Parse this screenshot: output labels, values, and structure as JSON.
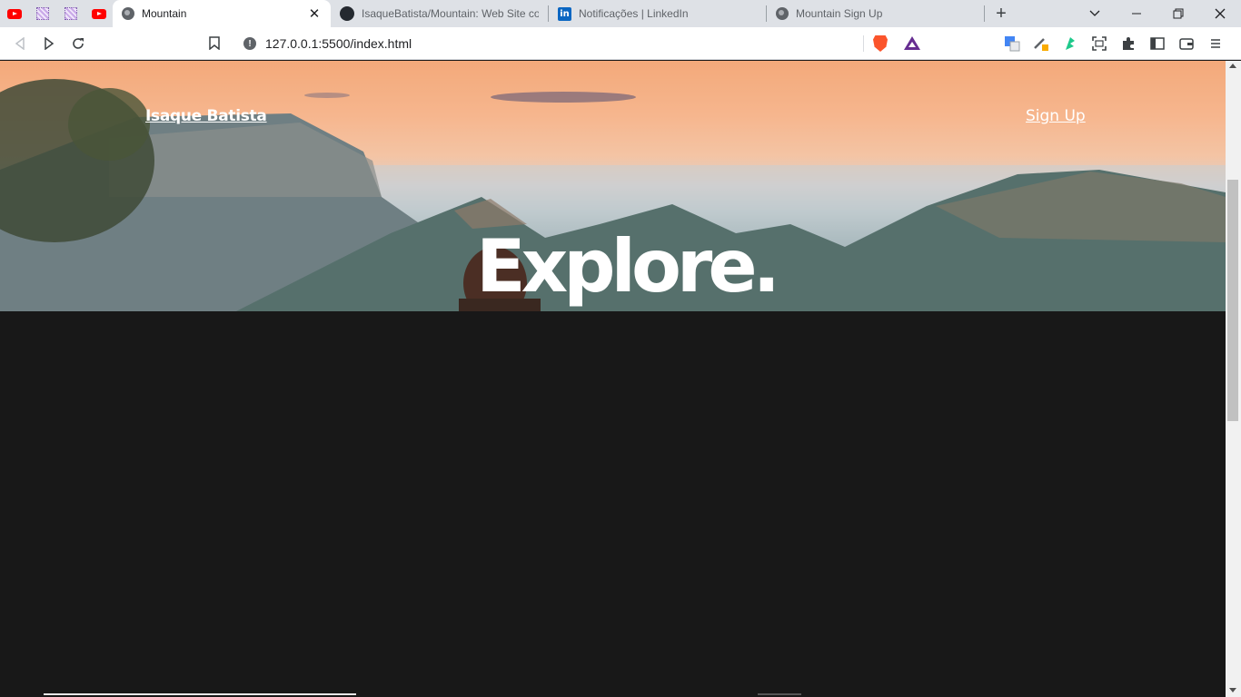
{
  "browser": {
    "tabs": [
      {
        "title": "Mountain",
        "active": true,
        "icon": "globe-icon"
      },
      {
        "title": "IsaqueBatista/Mountain: Web Site com",
        "active": false,
        "icon": "github-icon"
      },
      {
        "title": "Notificações | LinkedIn",
        "active": false,
        "icon": "linkedin-icon"
      },
      {
        "title": "Mountain Sign Up",
        "active": false,
        "icon": "globe-icon"
      }
    ],
    "linkedin_glyph": "in",
    "close_glyph": "✕",
    "new_tab_glyph": "+",
    "url": "127.0.0.1:5500/index.html",
    "info_glyph": "!"
  },
  "page": {
    "brand": "Isaque Batista",
    "signup": "Sign Up",
    "hero_title": "Explore."
  },
  "colors": {
    "page_bg": "#181818",
    "text": "#ffffff",
    "sky_top": "#f3a97a"
  }
}
